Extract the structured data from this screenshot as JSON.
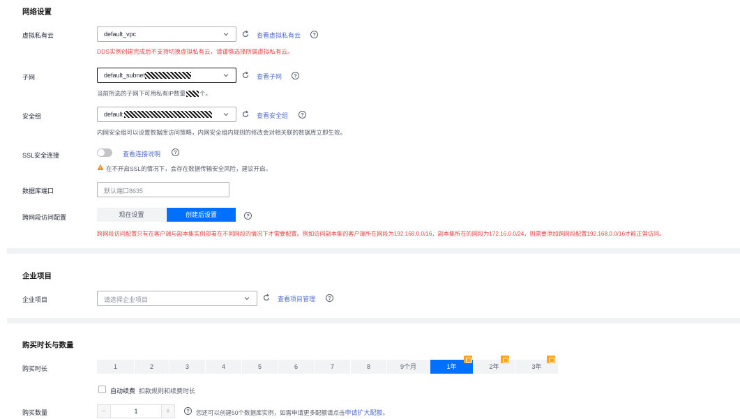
{
  "network": {
    "title": "网络设置",
    "vpc": {
      "label": "虚拟私有云",
      "value": "default_vpc",
      "link": "查看虚拟私有云",
      "error": "DDS实例创建完成后不支持切换虚拟私有云，请谨慎选择所属虚拟私有云。"
    },
    "subnet": {
      "label": "子网",
      "value": "default_subnet",
      "link": "查看子网",
      "hint_before": "当前所选的子网下可用私有IP数量",
      "hint_after": "个。"
    },
    "security_group": {
      "label": "安全组",
      "value": "default",
      "link": "查看安全组",
      "hint": "内网安全组可以设置数据库访问策略，内网安全组内规则的修改会对相关联的数据库立即生效。"
    },
    "ssl": {
      "label": "SSL安全连接",
      "enabled": false,
      "link": "查看连接说明",
      "warning": "在不开启SSL的情况下，会存在数据传输安全风险，建议开启。"
    },
    "port": {
      "label": "数据库端口",
      "placeholder": "默认端口8635"
    },
    "cross_cidr": {
      "label": "跨网段访问配置",
      "options": [
        "现在设置",
        "创建后设置"
      ],
      "selected": "创建后设置",
      "error": "跨网段访问配置只有在客户端与副本集实例部署在不同网段的情况下才需要配置。例如访问副本集的客户端所在网段为192.168.0.0/16，副本集所在的网段为172.16.0.0/24，则需要添加跨网段配置192.168.0.0/16才能正常访问。"
    }
  },
  "enterprise": {
    "title": "企业项目",
    "label": "企业项目",
    "placeholder": "请选择企业项目",
    "link": "查看项目管理"
  },
  "purchase": {
    "title": "购买时长与数量",
    "duration_label": "购买时长",
    "durations": [
      "1",
      "2",
      "3",
      "4",
      "5",
      "6",
      "7",
      "8",
      "9个月",
      "1年",
      "2年",
      "3年"
    ],
    "selected_duration": "1年",
    "auto_renew_label": "自动续费",
    "auto_renew_hint": "扣款规则和续费时长",
    "quantity_label": "购买数量",
    "quantity": "1",
    "minus": "−",
    "plus": "+",
    "quota_text": "您还可以创建50个数据库实例，如需申请更多配额请点击",
    "quota_link": "申请扩大配额",
    "quota_end": "。"
  },
  "colors": {
    "accent": "#0070ff",
    "link": "#526ecc",
    "error": "#e54545",
    "warning": "#ff8000",
    "gift": "#ffa31a"
  }
}
